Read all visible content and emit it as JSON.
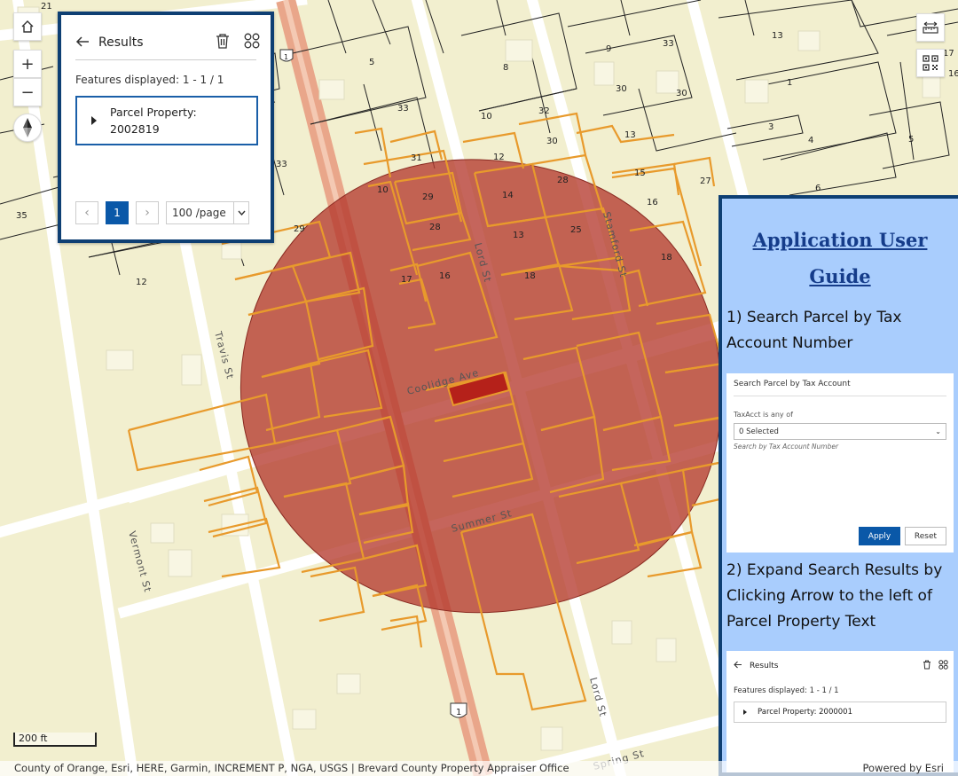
{
  "map": {
    "streets": [
      "Coolidge Ave",
      "Summer St",
      "Lord St",
      "Lord St",
      "Stamford St",
      "Travis St",
      "Vermont St",
      "Spring St"
    ],
    "lot_numbers": [
      "21",
      "5",
      "8",
      "33",
      "10",
      "32",
      "30",
      "13",
      "33",
      "9",
      "30",
      "13",
      "1",
      "17",
      "16",
      "5",
      "3",
      "4",
      "33",
      "31",
      "12",
      "14",
      "28",
      "29",
      "28",
      "10",
      "15",
      "27",
      "16",
      "6",
      "25",
      "18",
      "35",
      "29",
      "13",
      "18",
      "17",
      "16",
      "12",
      "13",
      "15",
      "18",
      "16"
    ],
    "road_numbers": [
      "1",
      "1"
    ],
    "colors": {
      "buffer": "#b53a2e",
      "parcel_outline": "#e89a2c",
      "selected": "#b5211a",
      "background": "#f2efcf",
      "highway": "#e9a68a"
    }
  },
  "controls": {
    "home_icon": "home-icon",
    "zoom_in": "+",
    "zoom_out": "−",
    "compass_icon": "compass-icon",
    "measure_icon": "measure-icon",
    "qr_icon": "qr-code-icon"
  },
  "results_panel": {
    "title": "Results",
    "count_text": "Features displayed: 1 - 1 / 1",
    "item_label": "Parcel Property: 2002819",
    "page_number": "1",
    "page_size": "100 /page",
    "prev_label": "‹",
    "next_label": "›"
  },
  "guide": {
    "title": "Application User Guide",
    "step1": "1) Search Parcel by Tax Account Number",
    "step2": "2) Expand Search Results by Clicking Arrow to the left of Parcel Property Text",
    "shot1": {
      "title": "Search Parcel by Tax Account",
      "field_label": "TaxAcct is any of",
      "select_value": "0 Selected",
      "hint": "Search by Tax Account Number",
      "apply": "Apply",
      "reset": "Reset"
    },
    "shot2": {
      "title": "Results",
      "count_text": "Features displayed: 1 - 1 / 1",
      "item_label": "Parcel Property: 2000001"
    }
  },
  "scale": "200 ft",
  "attribution": "County of Orange, Esri, HERE, Garmin, INCREMENT P, NGA, USGS | Brevard County Property Appraiser Office",
  "powered_by": "Powered by Esri"
}
